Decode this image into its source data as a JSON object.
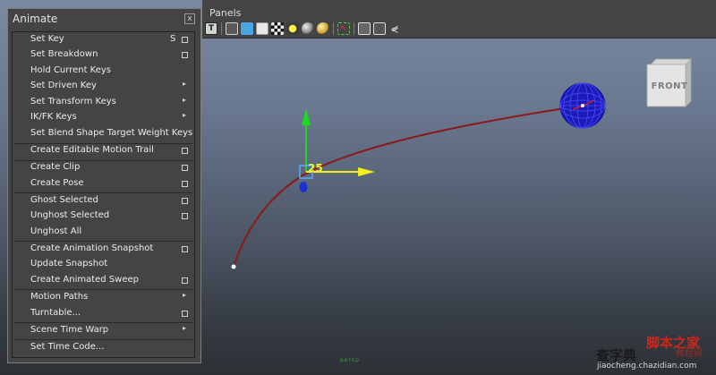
{
  "window": {
    "panels_menu": "Panels"
  },
  "toolbar": {
    "icons": [
      "text-t-icon",
      "wireframe-cube-icon",
      "smooth-shade-cube-icon",
      "textured-cube-icon",
      "checker-icon",
      "default-light-icon",
      "grey-sphere-icon",
      "gold-sphere-icon",
      "isolate-select-icon",
      "xray-cube-icon",
      "camera-frame-icon",
      "motion-trail-icon"
    ]
  },
  "menu": {
    "title": "Animate",
    "close_glyph": "x",
    "items": [
      {
        "label": "Set Key",
        "hotkey": "S",
        "option": true,
        "submenu": false
      },
      {
        "label": "Set Breakdown",
        "hotkey": "",
        "option": true,
        "submenu": false
      },
      {
        "label": "Hold Current Keys",
        "hotkey": "",
        "option": false,
        "submenu": false
      },
      {
        "label": "Set Driven Key",
        "hotkey": "",
        "option": false,
        "submenu": true
      },
      {
        "label": "Set Transform Keys",
        "hotkey": "",
        "option": false,
        "submenu": true
      },
      {
        "label": "IK/FK Keys",
        "hotkey": "",
        "option": false,
        "submenu": true
      },
      {
        "label": "Set Blend Shape Target Weight Keys",
        "hotkey": "",
        "option": false,
        "submenu": false
      },
      {
        "label": "Create Editable Motion Trail",
        "hotkey": "",
        "option": true,
        "submenu": false
      },
      {
        "label": "Create Clip",
        "hotkey": "",
        "option": true,
        "submenu": false
      },
      {
        "label": "Create Pose",
        "hotkey": "",
        "option": true,
        "submenu": false
      },
      {
        "label": "Ghost Selected",
        "hotkey": "",
        "option": true,
        "submenu": false
      },
      {
        "label": "Unghost Selected",
        "hotkey": "",
        "option": true,
        "submenu": false
      },
      {
        "label": "Unghost All",
        "hotkey": "",
        "option": false,
        "submenu": false
      },
      {
        "label": "Create Animation Snapshot",
        "hotkey": "",
        "option": true,
        "submenu": false
      },
      {
        "label": "Update Snapshot",
        "hotkey": "",
        "option": false,
        "submenu": false
      },
      {
        "label": "Create Animated Sweep",
        "hotkey": "",
        "option": true,
        "submenu": false
      },
      {
        "label": "Motion Paths",
        "hotkey": "",
        "option": false,
        "submenu": true
      },
      {
        "label": "Turntable...",
        "hotkey": "",
        "option": true,
        "submenu": false
      },
      {
        "label": "Scene Time Warp",
        "hotkey": "",
        "option": false,
        "submenu": true
      },
      {
        "label": "Set Time Code...",
        "hotkey": "",
        "option": false,
        "submenu": false
      }
    ]
  },
  "viewport": {
    "frame_number": "25",
    "viewcube_face": "FRONT",
    "bottom_mark": "persp"
  },
  "watermark": {
    "brand_top": "脚本之家",
    "brand_sub": "教程网",
    "brand_cn": "查字典",
    "url": "jiaocheng.chazidian.com"
  },
  "colors": {
    "menu_bg": "#444444",
    "viewport_top": "#7b8aa0",
    "viewport_bottom": "#2d3035",
    "motion_trail": "#8b1a1a",
    "sphere": "#1b1bb8",
    "frame_label": "#f3f320"
  }
}
